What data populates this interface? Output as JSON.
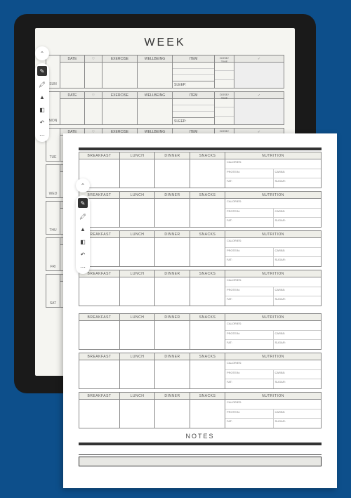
{
  "page1": {
    "title": "WEEK",
    "columns": {
      "date": "DATE",
      "heart": "♡",
      "exercise": "EXERCISE",
      "wellbeing": "WELLBEING",
      "item": "ITEM",
      "dose": "DOSE/\nTIME",
      "check": "✓",
      "sleep": "SLEEP:"
    },
    "days": [
      "SUN",
      "MON",
      "TUE",
      "WED",
      "THU",
      "FRI",
      "SAT"
    ]
  },
  "page2": {
    "columns": {
      "breakfast": "BREAKFAST",
      "lunch": "LUNCH",
      "dinner": "DINNER",
      "snacks": "SNACKS",
      "nutrition": "NUTRITION"
    },
    "nutrition": {
      "calories": "CALORIES:",
      "protein": "PROTEIN:",
      "carbs": "CARBS:",
      "fat": "FAT:",
      "sugar": "SUGAR:"
    },
    "rows": 7,
    "notes_title": "NOTES"
  },
  "toolbar": {
    "collapse": "⌃",
    "tools": [
      "pen",
      "brush",
      "marker",
      "eraser",
      "undo",
      "more"
    ]
  }
}
